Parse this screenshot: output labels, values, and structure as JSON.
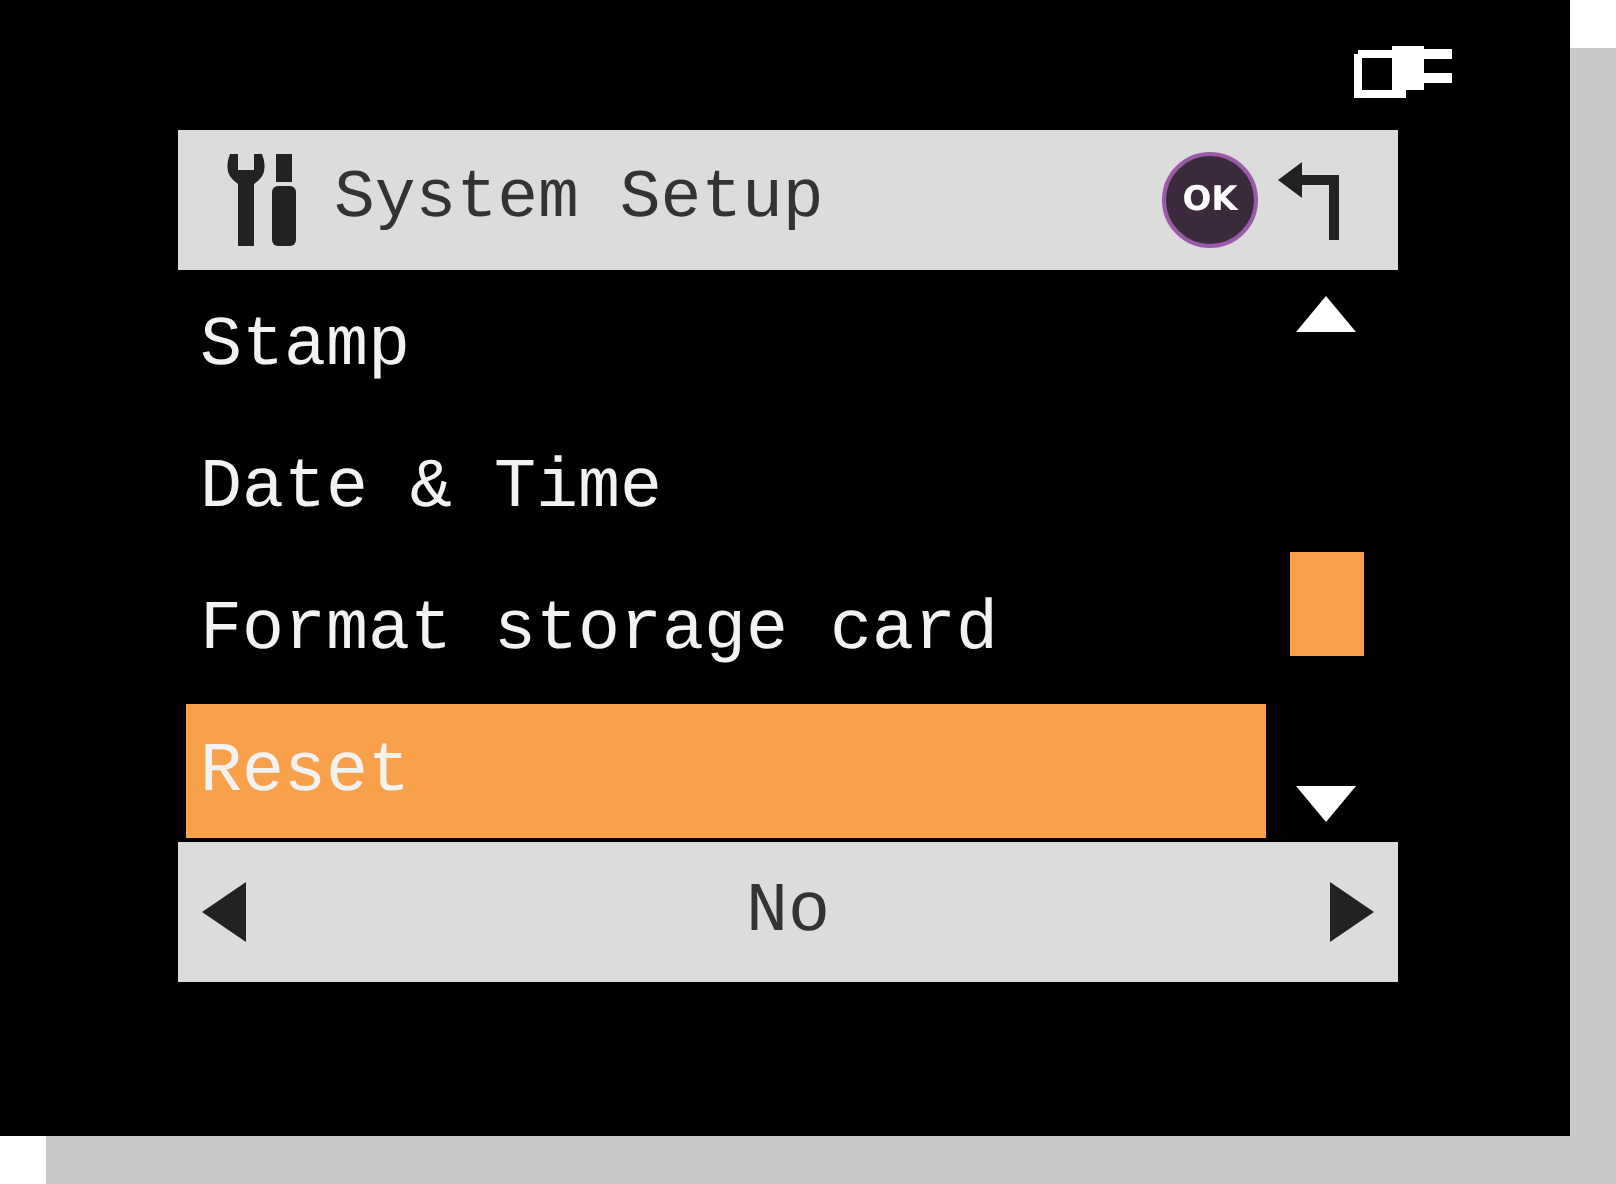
{
  "header": {
    "title": "System Setup",
    "ok_label": "OK"
  },
  "menu": [
    {
      "label": "Stamp",
      "selected": false
    },
    {
      "label": "Date & Time",
      "selected": false
    },
    {
      "label": "Format storage card",
      "selected": false
    },
    {
      "label": "Reset",
      "selected": true
    }
  ],
  "value_bar": {
    "value": "No"
  }
}
